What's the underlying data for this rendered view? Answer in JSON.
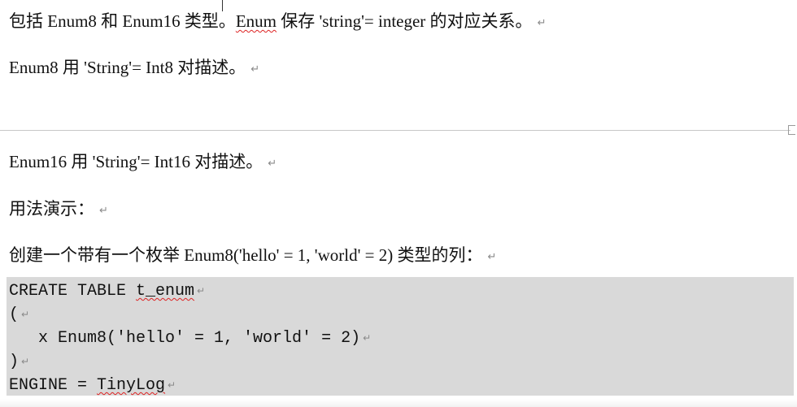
{
  "paragraphs": {
    "p1": {
      "before": "包括 Enum8 和 Enum16 类型。",
      "flagged_word": "Enum",
      "after": " 保存 'string'= integer 的对应关系。"
    },
    "p2": "Enum8 用 'String'= Int8 对描述。",
    "p3": "Enum16 用 'String'= Int16 对描述。",
    "p4": "用法演示：",
    "p5": "创建一个带有一个枚举 Enum8('hello' = 1, 'world' = 2) 类型的列："
  },
  "paragraph_mark": "↵",
  "code": {
    "line1_prefix": "CREATE TABLE ",
    "line1_flagged": "t_enum",
    "line2": "(",
    "line3": "   x Enum8('hello' = 1, 'world' = 2)",
    "line4": ")",
    "line5_prefix": "ENGINE = ",
    "line5_flagged": "TinyLog"
  },
  "colors": {
    "code_background": "#d9d9d9",
    "spellcheck_underline": "#dd2222",
    "paragraph_mark": "#8a8a8a",
    "page_break_line": "#c8c8c8"
  }
}
